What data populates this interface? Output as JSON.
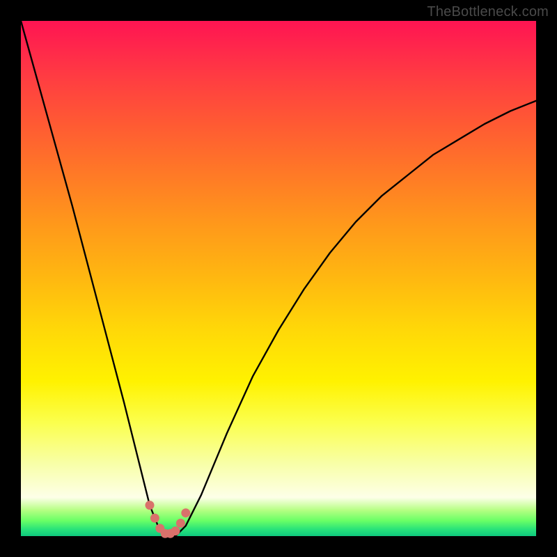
{
  "watermark": "TheBottleneck.com",
  "chart_data": {
    "type": "line",
    "title": "",
    "xlabel": "",
    "ylabel": "",
    "xlim": [
      0,
      100
    ],
    "ylim": [
      0,
      100
    ],
    "grid": false,
    "legend": false,
    "series": [
      {
        "name": "bottleneck-curve",
        "x": [
          0,
          5,
          10,
          15,
          20,
          23,
          25,
          27,
          29,
          30,
          32,
          35,
          40,
          45,
          50,
          55,
          60,
          65,
          70,
          75,
          80,
          85,
          90,
          95,
          100
        ],
        "y": [
          100,
          82,
          64,
          45,
          26,
          14,
          6,
          1,
          0,
          0,
          2,
          8,
          20,
          31,
          40,
          48,
          55,
          61,
          66,
          70,
          74,
          77,
          80,
          82.5,
          84.5
        ]
      },
      {
        "name": "marker-dots",
        "x": [
          25,
          26,
          27,
          28,
          29,
          30,
          31,
          32
        ],
        "y": [
          6,
          3.5,
          1.5,
          0.5,
          0.5,
          1,
          2.5,
          4.5
        ]
      }
    ],
    "colors": {
      "curve": "#000000",
      "dots": "#d9716b"
    }
  }
}
